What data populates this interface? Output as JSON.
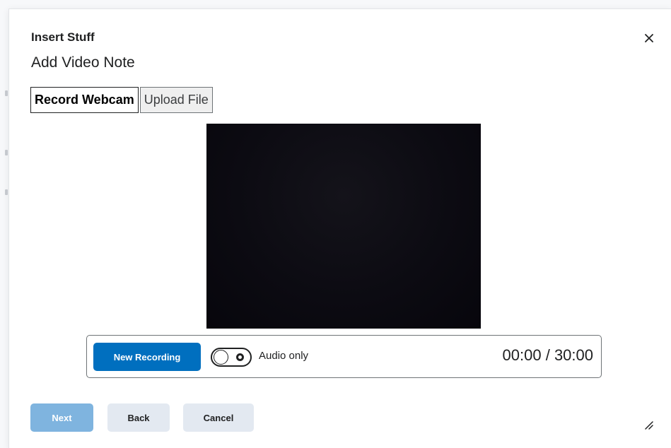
{
  "dialog": {
    "title": "Insert Stuff",
    "subtitle": "Add Video Note",
    "close_icon": "close-icon"
  },
  "tabs": [
    {
      "label": "Record Webcam",
      "active": true
    },
    {
      "label": "Upload File",
      "active": false
    }
  ],
  "recorder": {
    "new_recording_label": "New Recording",
    "audio_only_label": "Audio only",
    "audio_only_on": false,
    "timer": "00:00 / 30:00"
  },
  "footer": {
    "next_label": "Next",
    "back_label": "Back",
    "cancel_label": "Cancel"
  },
  "colors": {
    "primary": "#006fbf",
    "primary_disabled": "#7fb4df",
    "secondary_button": "#e3e9f1"
  },
  "icons": {
    "close": "close-icon",
    "resize": "resize-grip-icon"
  }
}
